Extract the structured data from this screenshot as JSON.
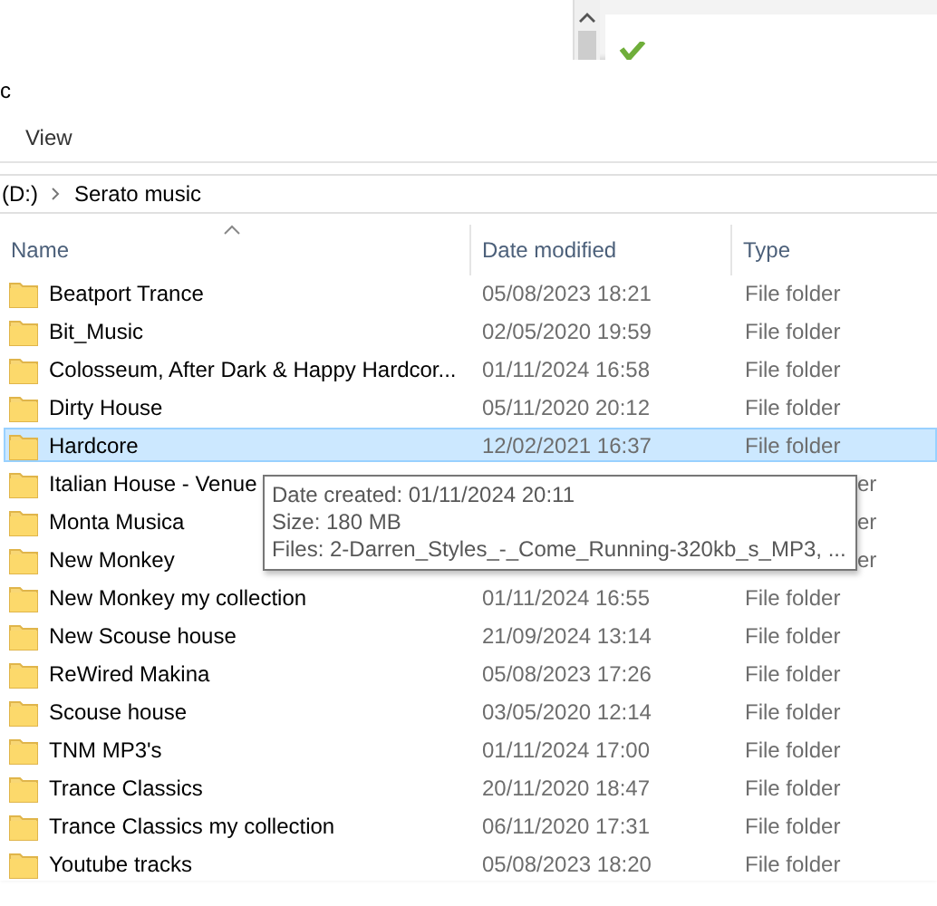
{
  "window": {
    "title": "c"
  },
  "menu": [
    "View"
  ],
  "address_bar": {
    "segments": [
      "(D:)",
      "Serato music"
    ]
  },
  "columns": [
    {
      "label": "Name",
      "sorted": true
    },
    {
      "label": "Date modified",
      "sorted": false
    },
    {
      "label": "Type",
      "sorted": false
    }
  ],
  "rows": [
    {
      "name": "Beatport Trance",
      "date_modified": "05/08/2023 18:21",
      "type": "File folder",
      "selected": false
    },
    {
      "name": "Bit_Music",
      "date_modified": "02/05/2020 19:59",
      "type": "File folder",
      "selected": false
    },
    {
      "name": "Colosseum, After Dark & Happy Hardcor...",
      "date_modified": "01/11/2024 16:58",
      "type": "File folder",
      "selected": false
    },
    {
      "name": "Dirty House",
      "date_modified": "05/11/2020 20:12",
      "type": "File folder",
      "selected": false
    },
    {
      "name": "Hardcore",
      "date_modified": "12/02/2021 16:37",
      "type": "File folder",
      "selected": true
    },
    {
      "name": "Italian House - Venue",
      "type": "er",
      "selected": false
    },
    {
      "name": "Monta Musica",
      "type": "er",
      "selected": false
    },
    {
      "name": "New Monkey",
      "type": "er",
      "selected": false
    },
    {
      "name": "New Monkey my collection",
      "date_modified": "01/11/2024 16:55",
      "type": "File folder",
      "selected": false
    },
    {
      "name": "New Scouse house",
      "date_modified": "21/09/2024 13:14",
      "type": "File folder",
      "selected": false
    },
    {
      "name": "ReWired Makina",
      "date_modified": "05/08/2023 17:26",
      "type": "File folder",
      "selected": false
    },
    {
      "name": "Scouse house",
      "date_modified": "03/05/2020 12:14",
      "type": "File folder",
      "selected": false
    },
    {
      "name": "TNM MP3's",
      "date_modified": "01/11/2024 17:00",
      "type": "File folder",
      "selected": false
    },
    {
      "name": "Trance Classics",
      "date_modified": "20/11/2020 18:47",
      "type": "File folder",
      "selected": false
    },
    {
      "name": "Trance Classics my collection",
      "date_modified": "06/11/2020 17:31",
      "type": "File folder",
      "selected": false
    },
    {
      "name": "Youtube tracks",
      "date_modified": "05/08/2023 18:20",
      "type": "File folder",
      "selected": false
    }
  ],
  "tooltip": {
    "lines": [
      "Date created: 01/11/2024 20:11",
      "Size: 180 MB",
      "Files: 2-Darren_Styles_-_Come_Running-320kb_s_MP3, ..."
    ]
  }
}
